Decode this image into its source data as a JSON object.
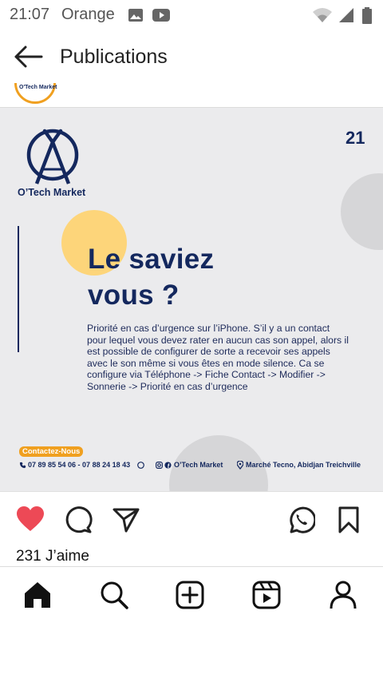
{
  "status_bar": {
    "time": "21:07",
    "carrier": "Orange",
    "icons": [
      "image-icon",
      "youtube-icon",
      "wifi-icon",
      "signal-icon",
      "battery-icon"
    ]
  },
  "header": {
    "title": "Publications",
    "back_icon": "arrow-left-icon"
  },
  "avatar": {
    "label": "O'Tech Market"
  },
  "post": {
    "number": "21",
    "brand": "O’Tech Market",
    "headline_line1": "Le saviez",
    "headline_line2": "vous ?",
    "body": "Priorité en cas d’urgence sur l’iPhone. S’il y a un contact pour lequel vous devez rater en aucun cas son appel, alors il est possible de configurer de sorte a recevoir ses appels avec le son même si vous êtes en mode silence. Ca se configure via Téléphone -> Fiche Contact -> Modifier -> Sonnerie -> Priorité en cas d’urgence",
    "contact_label": "Contactez-Nous",
    "phones": "07 89 85 54 06 - 07 88 24 18 43",
    "social": "O’Tech Market",
    "address": "Marché Tecno, Abidjan Treichville",
    "colors": {
      "navy": "#14285e",
      "yellow": "#fdd57a",
      "orange": "#f0a020",
      "background": "#ebebed"
    }
  },
  "actions": {
    "like_icon": "heart-filled-icon",
    "comment_icon": "comment-icon",
    "share_icon": "send-icon",
    "whatsapp_icon": "whatsapp-icon",
    "save_icon": "bookmark-icon",
    "like_color": "#ed4956"
  },
  "likes_text": "231 J’aime",
  "nav": {
    "items": [
      "home-icon",
      "search-icon",
      "add-post-icon",
      "reels-icon",
      "profile-icon"
    ]
  }
}
